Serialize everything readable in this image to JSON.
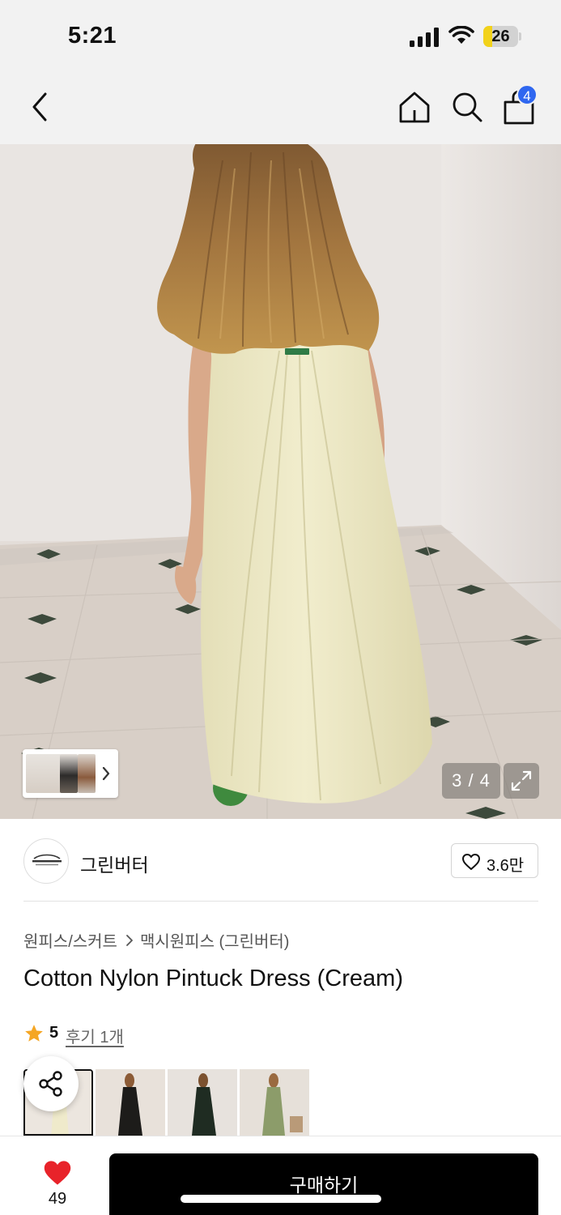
{
  "status_bar": {
    "time": "5:21",
    "battery_level": "26",
    "battery_fraction": 0.26
  },
  "nav": {
    "cart_badge": "4",
    "icons": [
      "back-chevron-icon",
      "home-icon",
      "search-icon",
      "shopping-bag-icon"
    ]
  },
  "gallery": {
    "counter": "3 / 4",
    "current_index": 3,
    "total": 4,
    "thumb_strip_icon": "chevron-right-icon",
    "expand_icon": "expand-icon"
  },
  "brand": {
    "name": "그린버터",
    "likes": "3.6만",
    "like_icon": "heart-outline-icon"
  },
  "breadcrumb": {
    "category": "원피스/스커트",
    "subcategory": "맥시원피스 (그린버터)"
  },
  "product": {
    "title": "Cotton Nylon Pintuck Dress (Cream)"
  },
  "rating": {
    "score": "5",
    "reviews_link": "후기 1개",
    "star_color": "#f5a623"
  },
  "color_options": [
    "cream",
    "black",
    "dark-green",
    "khaki"
  ],
  "bottom_bar": {
    "wish_count": "49",
    "buy_label": "구매하기",
    "heart_color": "#e8232a"
  },
  "colors": {
    "accent_badge": "#2f67f0",
    "battery_yellow": "#f2d21a",
    "buy_button": "#000000"
  }
}
